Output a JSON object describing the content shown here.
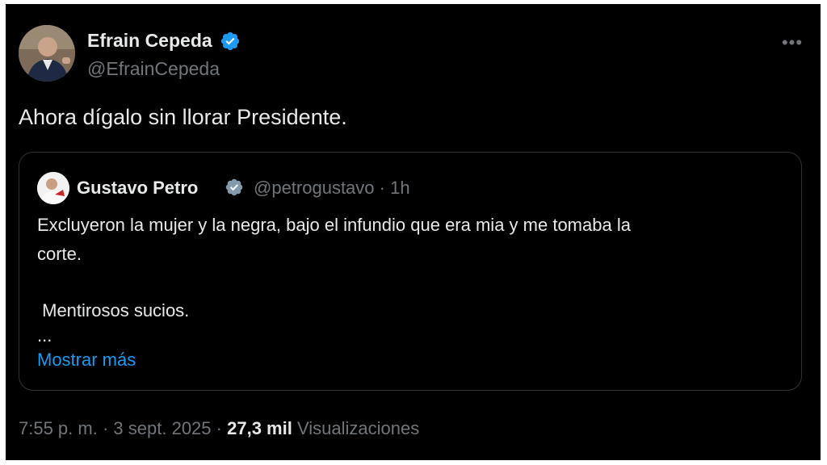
{
  "author": {
    "display_name": "Efrain Cepeda",
    "handle": "@EfrainCepeda",
    "verified": true
  },
  "tweet": {
    "text": "Ahora dígalo sin llorar Presidente."
  },
  "quoted": {
    "display_name": "Gustavo Petro",
    "handle": "@petrogustavo",
    "separator": "·",
    "time": "1h",
    "lines": [
      "Excluyeron la mujer y la negra, bajo el infundio que era mia y me tomaba la",
      "corte.",
      " Mentirosos sucios.",
      "..."
    ],
    "show_more": "Mostrar más"
  },
  "footer": {
    "time": "7:55 p. m.",
    "sep1": "·",
    "date": "3 sept. 2025",
    "sep2": "·",
    "views_count": "27,3 mil",
    "views_label": "Visualizaciones"
  },
  "more_icon": "more-horizontal-icon",
  "colors": {
    "background": "#000000",
    "text": "#e7e9ea",
    "muted": "#71767b",
    "link": "#1d9bf0",
    "verified": "#1d9bf0",
    "border": "#2f3336"
  }
}
